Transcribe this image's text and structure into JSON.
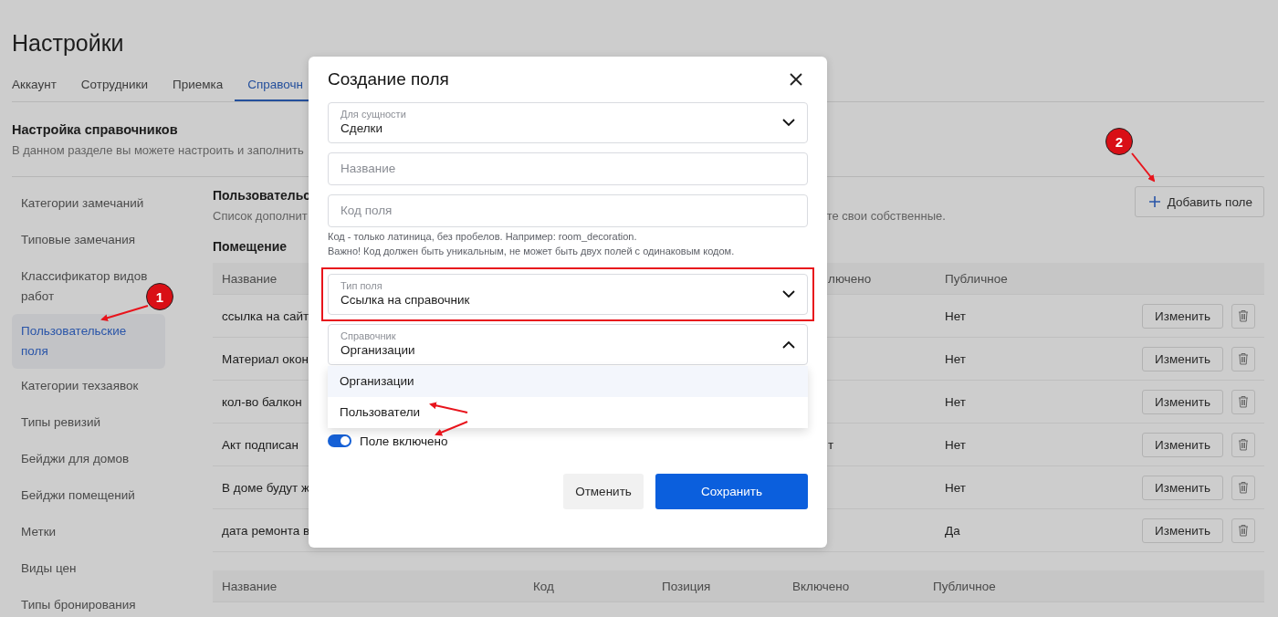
{
  "page_title": "Настройки",
  "tabs": [
    {
      "label": "Аккаунт",
      "selected": false
    },
    {
      "label": "Сотрудники",
      "selected": false
    },
    {
      "label": "Приемка",
      "selected": false
    },
    {
      "label": "Справочн",
      "selected": true
    }
  ],
  "section": {
    "title": "Настройка справочников",
    "description": "В данном разделе вы можете настроить и заполнить"
  },
  "sidebar": {
    "items": [
      {
        "label": "Категории замечаний",
        "selected": false
      },
      {
        "label": "Типовые замечания",
        "selected": false
      },
      {
        "label": "Классификатор видов работ",
        "selected": false
      },
      {
        "label": "Пользовательские поля",
        "selected": true
      },
      {
        "label": "Категории техзаявок",
        "selected": false
      },
      {
        "label": "Типы ревизий",
        "selected": false
      },
      {
        "label": "Бейджи для домов",
        "selected": false
      },
      {
        "label": "Бейджи помещений",
        "selected": false
      },
      {
        "label": "Метки",
        "selected": false
      },
      {
        "label": "Виды цен",
        "selected": false
      },
      {
        "label": "Типы бронирования",
        "selected": false
      }
    ]
  },
  "custom_fields": {
    "title": "Пользовательс",
    "description": "Список дополнит",
    "description_tail": "те свои собственные.",
    "add_button": "Добавить поле",
    "group": {
      "title": "Помещение",
      "columns": [
        "Название",
        "лючено",
        "Публичное"
      ],
      "rows": [
        {
          "name": "ссылка на сайт",
          "public": "Нет",
          "edit": "Изменить"
        },
        {
          "name": "Материал окон",
          "public": "Нет",
          "edit": "Изменить"
        },
        {
          "name": "кол-во балкон",
          "public": "Нет",
          "edit": "Изменить"
        },
        {
          "name": "Акт подписан",
          "column_2": "т",
          "public": "Нет",
          "edit": "Изменить"
        },
        {
          "name": "В доме будут ж",
          "public": "Нет",
          "edit": "Изменить"
        },
        {
          "name": "дата ремонта в",
          "public": "Да",
          "edit": "Изменить"
        }
      ]
    },
    "next_table_columns": [
      "Название",
      "Код",
      "Позиция",
      "Включено",
      "Публичное"
    ]
  },
  "dialog": {
    "title": "Создание поля",
    "fields": [
      {
        "kind": "select",
        "label": "Для сущности",
        "value": "Сделки",
        "open": false,
        "highlighted": false
      },
      {
        "kind": "input",
        "placeholder": "Название"
      },
      {
        "kind": "input",
        "placeholder": "Код поля"
      },
      {
        "kind": "hint",
        "lines": [
          "Код - только латиница, без пробелов. Например: room_decoration.",
          "Важно! Код должен быть уникальным, не может быть двух полей с одинаковым кодом."
        ]
      },
      {
        "kind": "select",
        "label": "Тип поля",
        "value": "Ссылка на справочник",
        "open": false,
        "highlighted": true
      },
      {
        "kind": "select",
        "label": "Справочник",
        "value": "Организации",
        "open": true,
        "highlighted": false,
        "options": [
          {
            "label": "Организации",
            "selected": true
          },
          {
            "label": "Пользователи",
            "selected": false
          }
        ]
      }
    ],
    "toggle": {
      "label": "Поле включено",
      "on": true
    },
    "cancel": "Отменить",
    "save": "Сохранить"
  },
  "annotations": [
    {
      "text": "1"
    },
    {
      "text": "2"
    }
  ]
}
